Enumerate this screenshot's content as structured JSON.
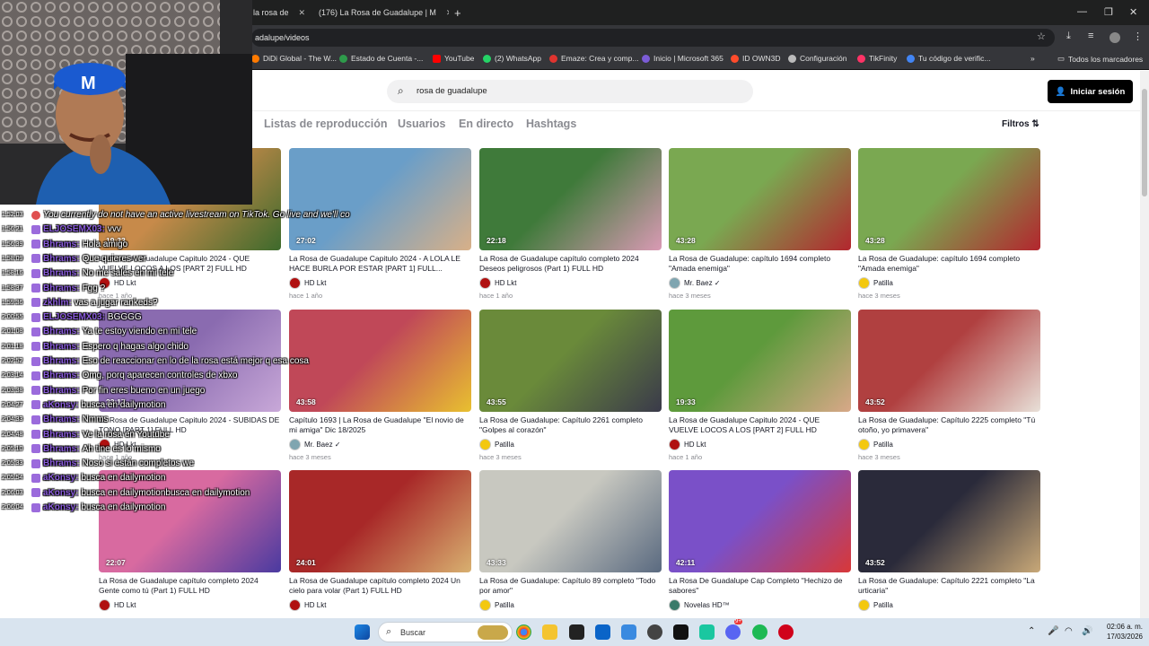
{
  "browser": {
    "tabs": [
      {
        "label": "la rosa de"
      },
      {
        "label": "(176) La Rosa de Guadalupe | M"
      }
    ],
    "new_tab": "+",
    "url": "adalupe/videos",
    "bookmarks": [
      {
        "label": "DiDi Global - The W...",
        "color": "#ff7a00"
      },
      {
        "label": "Estado de Cuenta -...",
        "color": "#2e9b4b"
      },
      {
        "label": "YouTube",
        "color": "#ff0000"
      },
      {
        "label": "(2) WhatsApp",
        "color": "#25d366"
      },
      {
        "label": "Emaze: Crea y comp...",
        "color": "#e0342f"
      },
      {
        "label": "Inicio | Microsoft 365",
        "color": "#7b5cd6"
      },
      {
        "label": "ID OWN3D",
        "color": "#ff4b2b"
      },
      {
        "label": "Configuración",
        "color": "#bbbbbb"
      },
      {
        "label": "TikFinity",
        "color": "#ff3366"
      },
      {
        "label": "Tu código de verific...",
        "color": "#4285f4"
      }
    ],
    "all_bookmarks": "Todos los marcadores"
  },
  "page": {
    "search_value": "rosa de guadalupe",
    "login_label": "Iniciar sesión",
    "nav_tabs": [
      "Listas de reproducción",
      "Usuarios",
      "En directo",
      "Hashtags"
    ],
    "filters_label": "Filtros"
  },
  "cards": [
    {
      "dur": "19:33",
      "title": "La Rosa de Guadalupe Capitulo 2024 - QUE VUELVE LOCOS A LOS [PART 2] FULL HD",
      "author": "HD Lkt",
      "date": "hace 1 año",
      "c1": "#c78a4a",
      "c2": "#3d6a2c",
      "av": "#b01010"
    },
    {
      "dur": "27:02",
      "title": "La Rosa de Guadalupe Capitulo 2024 - A LOLA LE HACE BURLA POR ESTAR [PART 1] FULL...",
      "author": "HD Lkt",
      "date": "hace 1 año",
      "c1": "#6a9ec8",
      "c2": "#d8b088",
      "av": "#b01010"
    },
    {
      "dur": "22:18",
      "title": "La Rosa de Guadalupe capítulo completo 2024 Deseos peligrosos (Part 1) FULL HD",
      "author": "HD Lkt",
      "date": "hace 1 año",
      "c1": "#3f7a3a",
      "c2": "#d99ab4",
      "av": "#b01010"
    },
    {
      "dur": "43:28",
      "title": "La Rosa de Guadalupe: capítulo 1694 completo \"Amada enemiga\"",
      "author": "Mr. Baez ✓",
      "date": "hace 3 meses",
      "c1": "#7aa851",
      "c2": "#b3262e",
      "av": "#7fa5b0"
    },
    {
      "dur": "43:28",
      "title": "La Rosa de Guadalupe: capítulo 1694 completo \"Amada enemiga\"",
      "author": "Patilla",
      "date": "hace 3 meses",
      "c1": "#7aa851",
      "c2": "#b3262e",
      "av": "#f3c80f"
    },
    {
      "dur": "23:17",
      "title": "La Rosa de Guadalupe Capitulo 2024 - SUBIDAS DE TONO [PART 1] FULL HD",
      "author": "HD Lkt",
      "date": "hace 1 año",
      "c1": "#8a6bb0",
      "c2": "#c8a8d8",
      "av": "#b01010"
    },
    {
      "dur": "43:58",
      "title": "Capítulo 1693 | La Rosa de Guadalupe \"El novio de mi amiga\" Dic 18/2025",
      "author": "Mr. Baez ✓",
      "date": "hace 3 meses",
      "c1": "#c04858",
      "c2": "#e8c030",
      "av": "#7fa5b0"
    },
    {
      "dur": "43:55",
      "title": "La Rosa de Guadalupe: Capítulo 2261 completo \"Golpes al corazón\"",
      "author": "Patilla",
      "date": "hace 3 meses",
      "c1": "#6a8a3a",
      "c2": "#3a3a4a",
      "av": "#f3c80f"
    },
    {
      "dur": "19:33",
      "title": "La Rosa de Guadalupe Capitulo 2024 - QUE VUELVE LOCOS A LOS [PART 2] FULL HD",
      "author": "HD Lkt",
      "date": "hace 1 año",
      "c1": "#5e9a3c",
      "c2": "#d8a888",
      "av": "#b01010"
    },
    {
      "dur": "43:52",
      "title": "La Rosa de Guadalupe: Capítulo 2225 completo \"Tú otoño, yo primavera\"",
      "author": "Patilla",
      "date": "hace 3 meses",
      "c1": "#b04040",
      "c2": "#e8e0d8",
      "av": "#f3c80f"
    },
    {
      "dur": "22:07",
      "title": "La Rosa de Guadalupe capítulo completo 2024 Gente como tú (Part 1) FULL HD",
      "author": "HD Lkt",
      "date": "",
      "c1": "#d86aa0",
      "c2": "#4a3aa0",
      "av": "#b01010"
    },
    {
      "dur": "24:01",
      "title": "La Rosa de Guadalupe capítulo completo 2024 Un cielo para volar (Part 1) FULL HD",
      "author": "HD Lkt",
      "date": "",
      "c1": "#a82828",
      "c2": "#d8b070",
      "av": "#b01010"
    },
    {
      "dur": "43:33",
      "title": "La Rosa de Guadalupe: Capítulo 89 completo \"Todo por amor\"",
      "author": "Patilla",
      "date": "",
      "c1": "#c8c8c0",
      "c2": "#5a6a80",
      "av": "#f3c80f"
    },
    {
      "dur": "42:11",
      "title": "La Rosa De Guadalupe Cap Completo \"Hechizo de sabores\"",
      "author": "Novelas HD™",
      "date": "",
      "c1": "#7a50c8",
      "c2": "#d83838",
      "av": "#3a7a6a"
    },
    {
      "dur": "43:52",
      "title": "La Rosa de Guadalupe: Capítulo 2221 completo \"La urticaria\"",
      "author": "Patilla",
      "date": "",
      "c1": "#2a2a3a",
      "c2": "#c8a878",
      "av": "#f3c80f"
    }
  ],
  "chat": [
    {
      "ts": "1:52:03",
      "user": "",
      "msg": "You currently do not have an active livestream on TikTok. Go live and we'll co",
      "sys": true
    },
    {
      "ts": "1:56:21",
      "user": "ELJOSEMX03:",
      "msg": "vvv"
    },
    {
      "ts": "1:56:39",
      "user": "Bhrams:",
      "msg": "Hola amigo"
    },
    {
      "ts": "1:58:09",
      "user": "Bhrams:",
      "msg": "Que quieres ver"
    },
    {
      "ts": "1:58:16",
      "user": "Bhrams:",
      "msg": "No me sales en mi tele"
    },
    {
      "ts": "1:58:37",
      "user": "Bhrams:",
      "msg": "Fgg ?"
    },
    {
      "ts": "1:59:36",
      "user": "zkhlm:",
      "msg": "vas a jugar rankeds?"
    },
    {
      "ts": "2:00:55",
      "user": "ELJOSEMX03:",
      "msg": "BGGGG"
    },
    {
      "ts": "2:01:08",
      "user": "Bhrams:",
      "msg": "Ya te estoy viendo en mi tele"
    },
    {
      "ts": "2:01:18",
      "user": "Bhrams:",
      "msg": "Espero q hagas algo chido"
    },
    {
      "ts": "2:02:52",
      "user": "Bhrams:",
      "msg": "Eso de reaccionar en lo de la rosa está mejor q esa cosa"
    },
    {
      "ts": "2:03:14",
      "user": "Bhrams:",
      "msg": "Omg, porq aparecen controles de xbxo"
    },
    {
      "ts": "2:03:38",
      "user": "Bhrams:",
      "msg": "Por fin eres bueno en un juego"
    },
    {
      "ts": "2:04:27",
      "user": "aKonsy:",
      "msg": "busca en dailymotion"
    },
    {
      "ts": "2:04:33",
      "user": "Bhrams:",
      "msg": "Nmms"
    },
    {
      "ts": "2:04:48",
      "user": "Bhrams:",
      "msg": "Ve la rosa en Youtube"
    },
    {
      "ts": "2:05:10",
      "user": "Bhrams:",
      "msg": "Ah tine es lo mismo"
    },
    {
      "ts": "2:05:33",
      "user": "Bhrams:",
      "msg": "Noso si están completos we"
    },
    {
      "ts": "2:05:54",
      "user": "aKonsy:",
      "msg": "busca en dailymotion"
    },
    {
      "ts": "2:06:03",
      "user": "aKonsy:",
      "msg": "busca en dailymotionbusca en dailymotion"
    },
    {
      "ts": "2:06:04",
      "user": "aKonsy:",
      "msg": "busca en dailymotion"
    }
  ],
  "taskbar": {
    "search": "Buscar",
    "time": "02:06 a. m.",
    "date": "17/03/2026",
    "discord_badge": "9+"
  }
}
